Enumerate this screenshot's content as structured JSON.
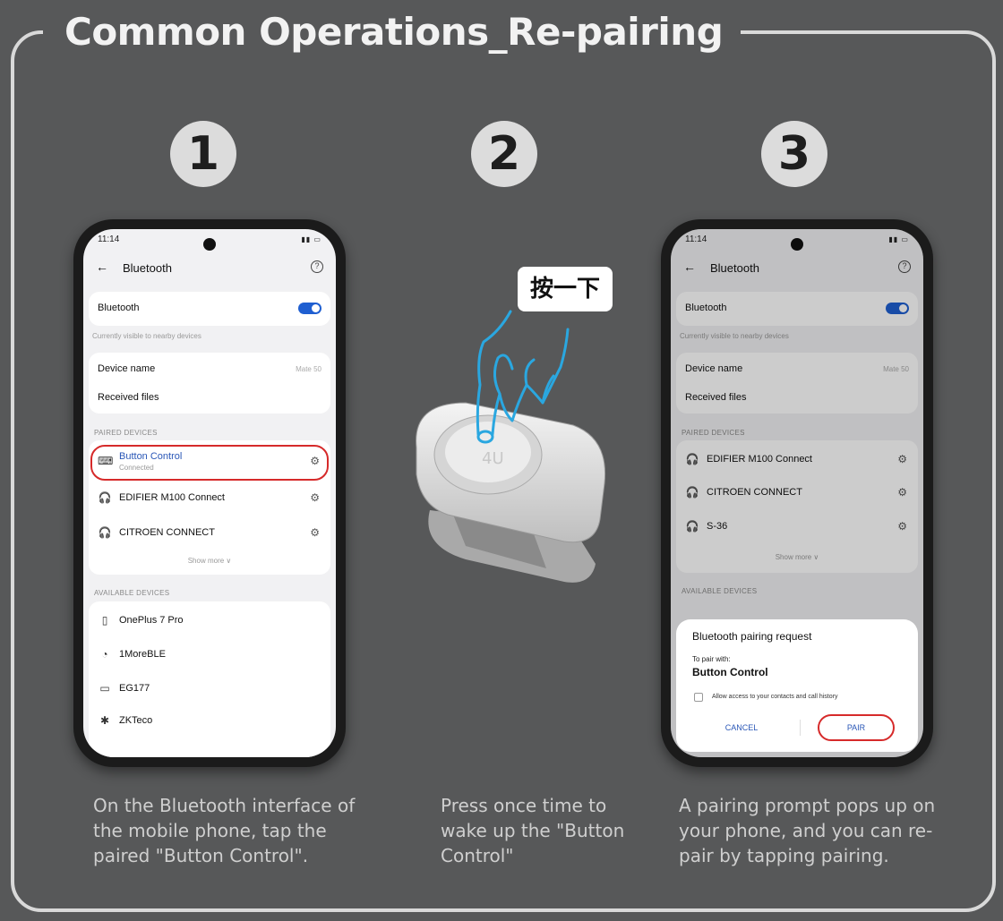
{
  "title": "Common Operations_Re-pairing",
  "steps": [
    {
      "number": "1",
      "caption_lines": [
        "On the Bluetooth interface of",
        "the mobile phone, tap the",
        "paired \"Button Control\"."
      ]
    },
    {
      "number": "2",
      "caption_lines": [
        "Press once time to",
        "wake up the \"Button",
        "Control\""
      ]
    },
    {
      "number": "3",
      "caption_lines": [
        "A pairing prompt pops up on",
        "your phone, and you can re-",
        "pair by tapping pairing."
      ]
    }
  ],
  "press_label": "按一下",
  "device_logo_text": "4U",
  "phone1": {
    "time": "11:14",
    "header": "Bluetooth",
    "bluetooth_label": "Bluetooth",
    "bluetooth_on": true,
    "visible_text": "Currently visible to nearby devices",
    "device_name_label": "Device name",
    "device_name_value": "Mate 50",
    "received_files_label": "Received files",
    "paired_section": "PAIRED DEVICES",
    "paired_devices": [
      {
        "name": "Button Control",
        "status": "Connected",
        "icon": "keyboard-icon"
      },
      {
        "name": "EDIFIER M100 Connect",
        "icon": "headphones-icon"
      },
      {
        "name": "CITROEN CONNECT",
        "icon": "headphones-icon"
      }
    ],
    "show_more": "Show more",
    "available_section": "AVAILABLE DEVICES",
    "available_devices": [
      {
        "name": "OnePlus 7 Pro",
        "icon": "phone-icon"
      },
      {
        "name": "1MoreBLE",
        "icon": "speaker-icon"
      },
      {
        "name": "EG177",
        "icon": "laptop-icon"
      },
      {
        "name": "ZKTeco",
        "icon": "bluetooth-icon"
      }
    ]
  },
  "phone3": {
    "time": "11:14",
    "header": "Bluetooth",
    "bluetooth_label": "Bluetooth",
    "visible_text": "Currently visible to nearby devices",
    "device_name_label": "Device name",
    "device_name_value": "Mate 50",
    "received_files_label": "Received files",
    "paired_section": "PAIRED DEVICES",
    "paired_devices": [
      {
        "name": "EDIFIER M100 Connect"
      },
      {
        "name": "CITROEN CONNECT"
      },
      {
        "name": "S-36"
      }
    ],
    "show_more": "Show more",
    "available_section": "AVAILABLE DEVICES",
    "dialog": {
      "title": "Bluetooth pairing request",
      "to_pair": "To pair with:",
      "device": "Button Control",
      "allow": "Allow access to your contacts and call history",
      "cancel": "CANCEL",
      "pair": "PAIR"
    }
  },
  "colors": {
    "background": "#575859",
    "accent_red": "#d62a2a",
    "toggle_blue": "#1f5fd1",
    "hand_blue": "#2aa7e0"
  }
}
